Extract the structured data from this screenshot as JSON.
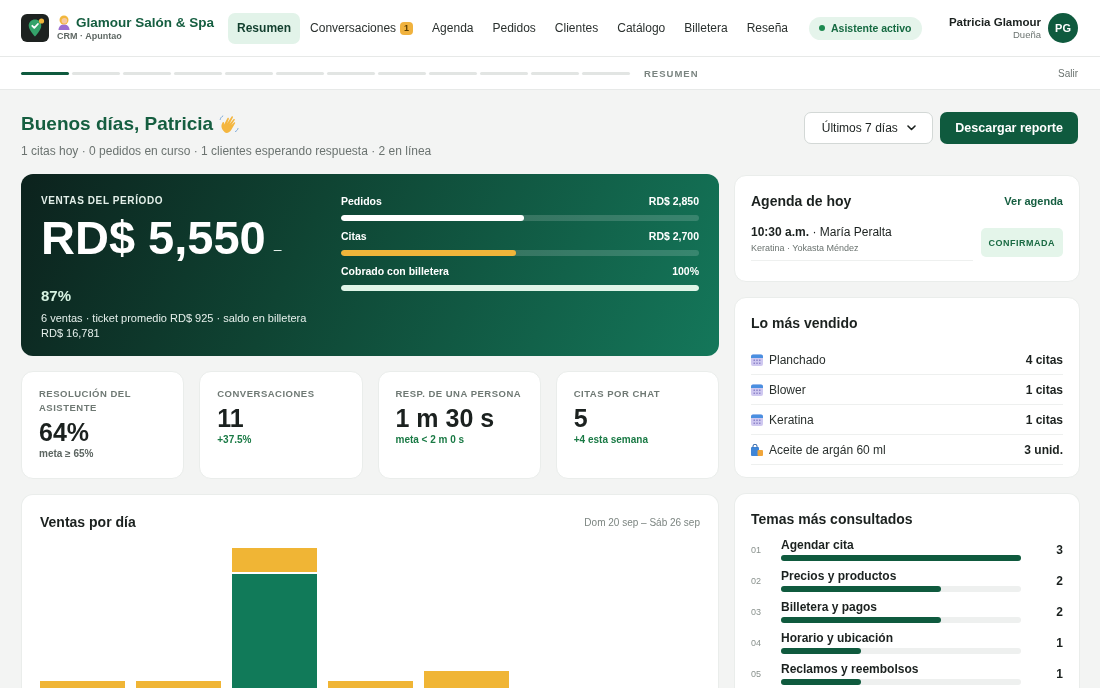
{
  "header": {
    "brand": {
      "name": "Glamour Salón & Spa",
      "subtitle": "CRM · Apuntao"
    },
    "nav": [
      {
        "label": "Resumen",
        "selected": true
      },
      {
        "label": "Conversaciones",
        "selected": false,
        "badge": "1"
      },
      {
        "label": "Agenda",
        "selected": false
      },
      {
        "label": "Pedidos",
        "selected": false
      },
      {
        "label": "Clientes",
        "selected": false
      },
      {
        "label": "Catálogo",
        "selected": false
      },
      {
        "label": "Billetera",
        "selected": false
      },
      {
        "label": "Reseña",
        "selected": false
      }
    ],
    "status": {
      "label": "Asistente activo",
      "active": true
    },
    "user": {
      "name": "Patricia Glamour",
      "role": "Dueña",
      "initials": "PG"
    }
  },
  "tour": {
    "steps": [
      {
        "active": true
      },
      {
        "active": false
      },
      {
        "active": false
      },
      {
        "active": false
      },
      {
        "active": false
      },
      {
        "active": false
      },
      {
        "active": false
      },
      {
        "active": false
      },
      {
        "active": false
      },
      {
        "active": false
      },
      {
        "active": false
      },
      {
        "active": false
      }
    ],
    "label": "RESUMEN",
    "exit": "Salir"
  },
  "greeting": {
    "title": "Buenos días, Patricia",
    "subtitle": "1 citas hoy · 0 pedidos en curso · 1 clientes esperando respuesta · 2 en línea"
  },
  "toolbar": {
    "period": "Últimos 7 días",
    "download": "Descargar reporte"
  },
  "sales_card": {
    "label": "VENTAS DEL PERÍODO",
    "amount": "RD$ 5,550",
    "change": "–",
    "percent": "87%",
    "details": "6 ventas · ticket promedio RD$ 925 · saldo en billetera RD$ 16,781",
    "breakdown": [
      {
        "label": "Pedidos",
        "value": "RD$ 2,850",
        "level": 0.51,
        "color": "#ffffff"
      },
      {
        "label": "Citas",
        "value": "RD$ 2,700",
        "level": 0.49,
        "color": "#f0b53a"
      },
      {
        "label": "Cobrado con billetera",
        "value": "100%",
        "level": 1,
        "color": "#dff5e8"
      }
    ]
  },
  "kpis": [
    {
      "label": "RESOLUCIÓN DEL ASISTENTE",
      "value": "64%",
      "note": "meta ≥ 65%",
      "positive": false
    },
    {
      "label": "CONVERSACIONES",
      "value": "11",
      "note": "+37.5%",
      "positive": true
    },
    {
      "label": "RESP. DE UNA PERSONA",
      "value": "1 m 30 s",
      "note": "meta < 2 m 0 s",
      "positive": true
    },
    {
      "label": "CITAS POR CHAT",
      "value": "5",
      "note": "+4 esta semana",
      "positive": true
    }
  ],
  "agenda": {
    "title": "Agenda de hoy",
    "link": "Ver agenda",
    "items": [
      {
        "summary": "**10:30 a.m.** · María Peralta",
        "details": "Keratina · Yokasta Méndez",
        "status": "CONFIRMADA",
        "kind": "confirmed"
      }
    ]
  },
  "best_sellers": {
    "title": "Lo más vendido",
    "items": [
      {
        "kind": "service",
        "name": "Planchado",
        "count": "4 citas"
      },
      {
        "kind": "service",
        "name": "Blower",
        "count": "1 citas"
      },
      {
        "kind": "service",
        "name": "Keratina",
        "count": "1 citas"
      },
      {
        "kind": "product",
        "name": "Aceite de argán 60 ml",
        "count": "3 unid."
      }
    ]
  },
  "sales_chart": {
    "title": "Ventas por día",
    "range": "Dom 20 sep – Sáb 26 sep"
  },
  "topics": {
    "title": "Temas más consultados",
    "items": [
      {
        "rank": "01",
        "label": "Agendar cita",
        "count": "3",
        "level": 1
      },
      {
        "rank": "02",
        "label": "Precios y productos",
        "count": "2",
        "level": 0.667
      },
      {
        "rank": "03",
        "label": "Billetera y pagos",
        "count": "2",
        "level": 0.667
      },
      {
        "rank": "04",
        "label": "Horario y ubicación",
        "count": "1",
        "level": 0.333
      },
      {
        "rank": "05",
        "label": "Reclamos y reembolsos",
        "count": "1",
        "level": 0.333
      }
    ]
  }
}
